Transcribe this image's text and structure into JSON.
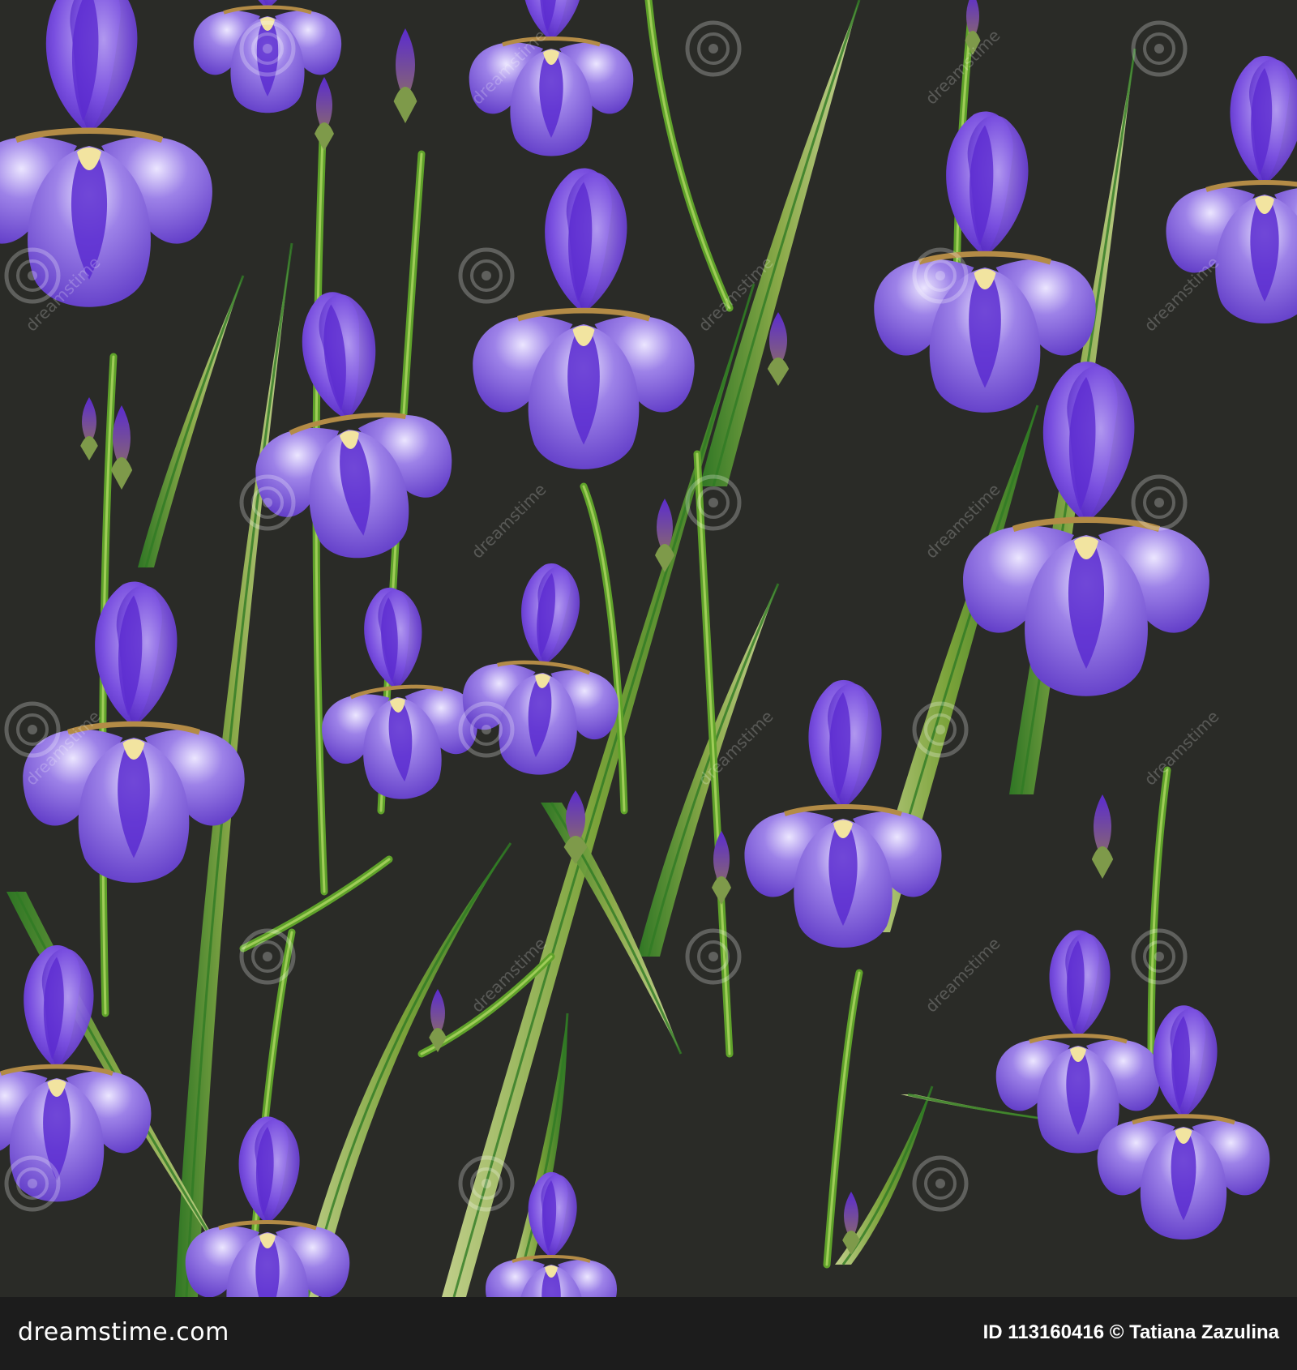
{
  "footer": {
    "site": "dreamstime.com",
    "id_label": "ID 113160416",
    "copyright": "© Tatiana Zazulina"
  },
  "watermark": {
    "text": "dreamstime"
  },
  "colors": {
    "background": "#2a2b27",
    "petal_light": "#8f6ee0",
    "petal_deep": "#5b2bd0",
    "petal_mid": "#7a4fe0",
    "leaf_green": "#6e9a2c",
    "leaf_light": "#c3d488",
    "footer_bg": "#1c1c1c"
  }
}
